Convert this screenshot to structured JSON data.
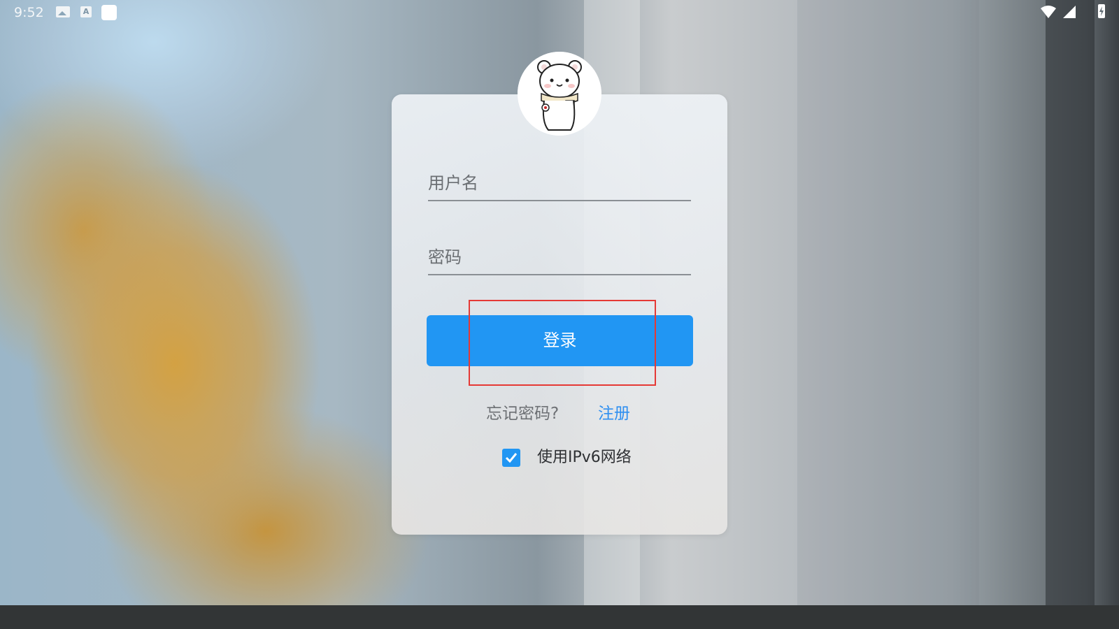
{
  "status_bar": {
    "time": "9:52",
    "icons": [
      "image-notification-icon",
      "text-a-notification-icon",
      "app-notification-icon",
      "wifi-icon",
      "cell-signal-icon",
      "battery-charging-icon"
    ]
  },
  "login_card": {
    "avatar": "polar-bear-avatar",
    "username_placeholder": "用户名",
    "password_placeholder": "密码",
    "login_label": "登录",
    "forgot_password": "忘记密码?",
    "register": "注册",
    "ipv6_label": "使用IPv6网络",
    "ipv6_checked": true
  },
  "colors": {
    "primary": "#2196f3",
    "link": "#2f8ff0",
    "highlight": "#e53935",
    "nav_bar": "#323536"
  }
}
